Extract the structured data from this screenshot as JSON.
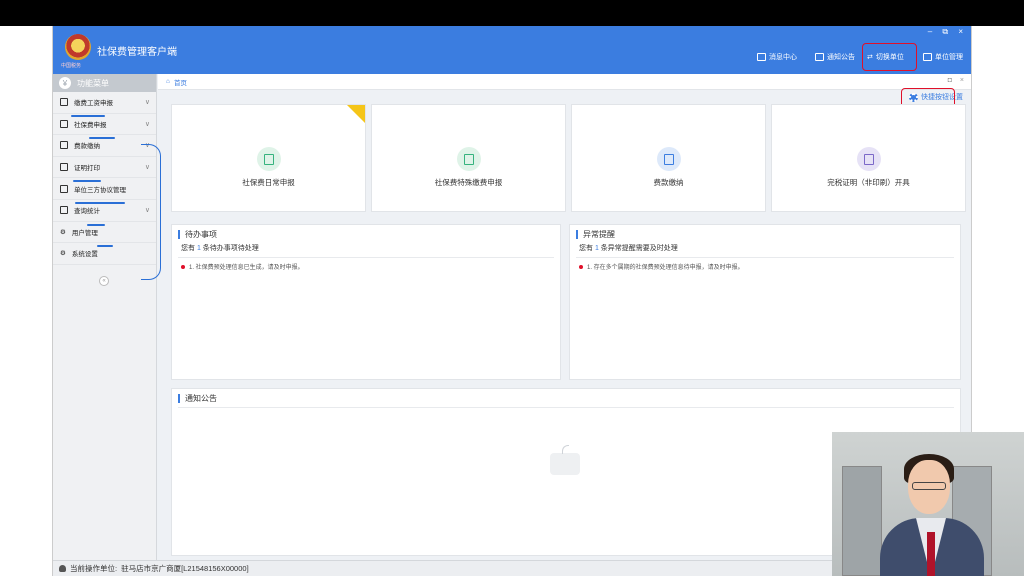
{
  "app": {
    "title": "社保费管理客户端",
    "logo_sub": "中国税务",
    "window_controls": "– ⧉ ×"
  },
  "header": {
    "items": [
      {
        "label": "消息中心",
        "icon": "message-icon"
      },
      {
        "label": "通知公告",
        "icon": "notice-icon"
      },
      {
        "label": "切换单位",
        "icon": "switch-icon"
      },
      {
        "label": "单位管理",
        "icon": "unit-icon"
      }
    ]
  },
  "sidebar": {
    "header": "功能菜单",
    "items": [
      {
        "label": "缴费工资申报",
        "icon": "edit-icon",
        "chevron": "∨"
      },
      {
        "label": "社保费申报",
        "icon": "form-icon",
        "chevron": "∨"
      },
      {
        "label": "费款缴纳",
        "icon": "book-icon",
        "chevron": "∨"
      },
      {
        "label": "证明打印",
        "icon": "print-icon",
        "chevron": "∨"
      },
      {
        "label": "单位三方协议管理",
        "icon": "book-icon",
        "chevron": ""
      },
      {
        "label": "查询统计",
        "icon": "chart-icon",
        "chevron": "∨"
      },
      {
        "label": "用户管理",
        "icon": "gear-icon",
        "chevron": ""
      },
      {
        "label": "系统设置",
        "icon": "gear-icon",
        "chevron": ""
      }
    ],
    "collapse": "«"
  },
  "breadcrumb": {
    "home": "首页",
    "controls": "◘ ×"
  },
  "quick_link": "快捷按钮设置",
  "cards": [
    {
      "label": "社保费日常申报",
      "icon": "calendar-icon",
      "color": "#35b37e",
      "bg": "#dff3e8",
      "flag": true
    },
    {
      "label": "社保费特殊缴费申报",
      "icon": "calendar-icon",
      "color": "#35b37e",
      "bg": "#dff3e8",
      "flag": false
    },
    {
      "label": "费款缴纳",
      "icon": "book-icon",
      "color": "#3b7de0",
      "bg": "#dde9fa",
      "flag": false
    },
    {
      "label": "完税证明（非印刷）开具",
      "icon": "printer-icon",
      "color": "#7b68c8",
      "bg": "#e6e2f6",
      "flag": false
    }
  ],
  "todo": {
    "title": "待办事项",
    "sub_prefix": "您有 ",
    "sub_count": "1",
    "sub_suffix": " 条待办事项待处理",
    "items": [
      "1. 社保费预处理信息已生成，请及时申报。"
    ]
  },
  "alerts": {
    "title": "异常提醒",
    "sub_prefix": "您有 ",
    "sub_count": "1",
    "sub_suffix": " 条异常提醒需要及时处理",
    "items": [
      "1. 存在多个属期的社保费预处理信息待申报，请及时申报。"
    ]
  },
  "announcements": {
    "title": "通知公告"
  },
  "status": {
    "label": "当前操作单位:",
    "value": "驻马店市京广商厦[L21548156X00000]"
  }
}
